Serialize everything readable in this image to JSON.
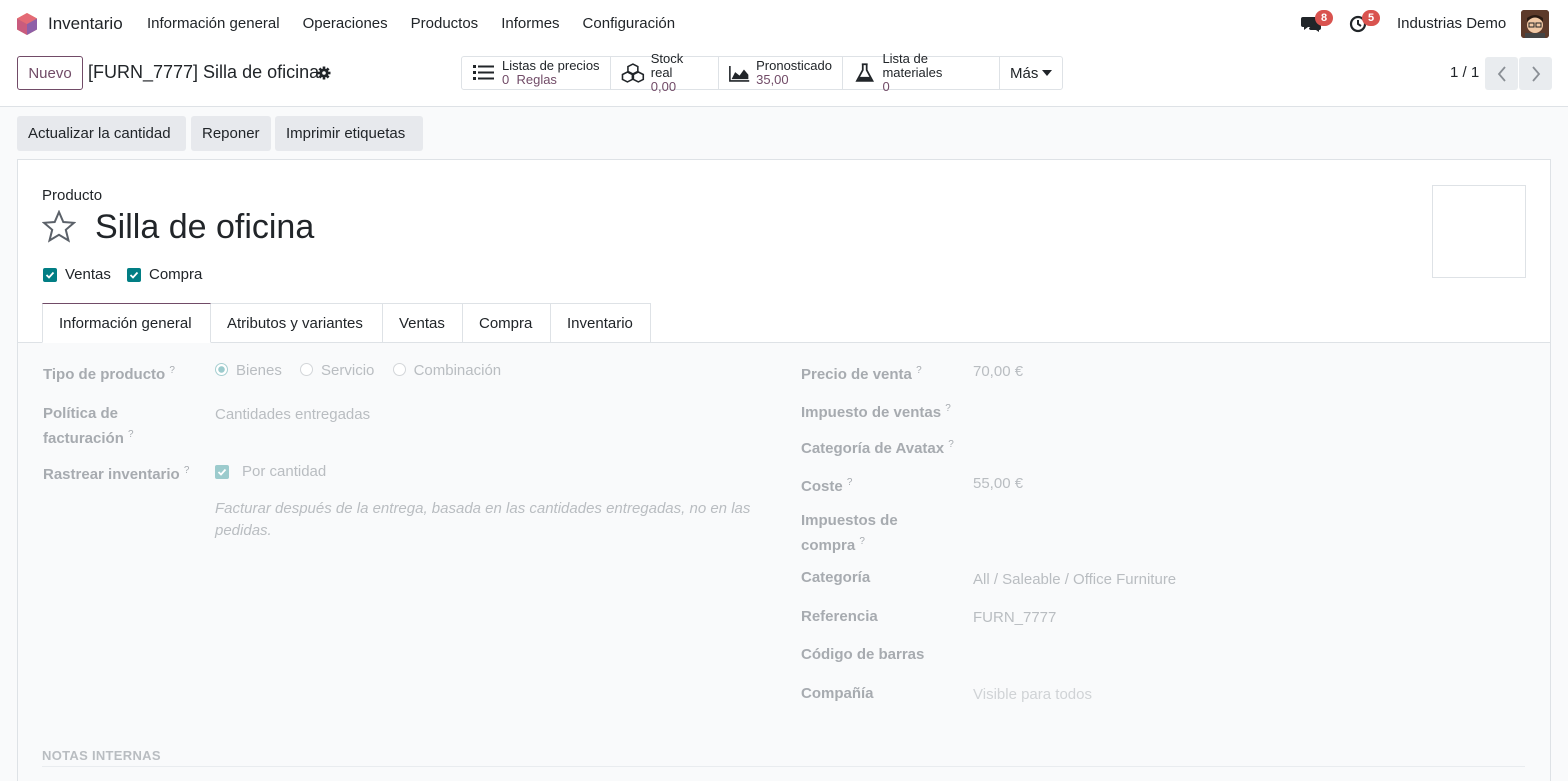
{
  "navbar": {
    "app_name": "Inventario",
    "menu": [
      "Información general",
      "Operaciones",
      "Productos",
      "Informes",
      "Configuración"
    ],
    "messages_count": "8",
    "activities_count": "5",
    "company": "Industrias Demo"
  },
  "control_panel": {
    "new_label": "Nuevo",
    "breadcrumb": "[FURN_7777] Silla de oficina",
    "smart_buttons": [
      {
        "label": "Listas de precios",
        "value": "0",
        "suffix": "Reglas",
        "icon": "list-icon"
      },
      {
        "label": "Stock real",
        "value": "0,00",
        "icon": "cubes-icon"
      },
      {
        "label": "Pronosticado",
        "value": "35,00",
        "icon": "area-chart-icon"
      },
      {
        "label": "Lista de materiales",
        "value": "0",
        "icon": "flask-icon"
      }
    ],
    "more_label": "Más",
    "pager": "1 / 1"
  },
  "actions": [
    "Actualizar la cantidad",
    "Reponer",
    "Imprimir etiquetas"
  ],
  "product": {
    "label": "Producto",
    "name": "Silla de oficina",
    "sale_ok": "Ventas",
    "purchase_ok": "Compra"
  },
  "tabs": [
    "Información general",
    "Atributos y variantes",
    "Ventas",
    "Compra",
    "Inventario"
  ],
  "left_fields": {
    "product_type_label": "Tipo de producto",
    "product_type_options": [
      "Bienes",
      "Servicio",
      "Combinación"
    ],
    "product_type_selected": "Bienes",
    "invoice_policy_label_1": "Política de",
    "invoice_policy_label_2": "facturación",
    "invoice_policy_value": "Cantidades entregadas",
    "track_inventory_label": "Rastrear inventario",
    "track_inventory_value": "Por cantidad",
    "note": "Facturar después de la entrega, basada en las cantidades entregadas, no en las pedidas."
  },
  "right_fields": {
    "sale_price_label": "Precio de venta",
    "sale_price_value": "70,00 €",
    "sale_tax_label": "Impuesto de ventas",
    "avatax_label": "Categoría de Avatax",
    "cost_label": "Coste",
    "cost_value": "55,00 €",
    "purchase_tax_label_1": "Impuestos de",
    "purchase_tax_label_2": "compra",
    "category_label": "Categoría",
    "category_value": "All / Saleable / Office Furniture",
    "reference_label": "Referencia",
    "reference_value": "FURN_7777",
    "barcode_label": "Código de barras",
    "company_label": "Compañía",
    "company_value": "Visible para todos"
  },
  "notes_header": "NOTAS INTERNAS",
  "colors": {
    "brand": "#714b67",
    "checkbox": "#017e84",
    "badge": "#d9534f"
  }
}
